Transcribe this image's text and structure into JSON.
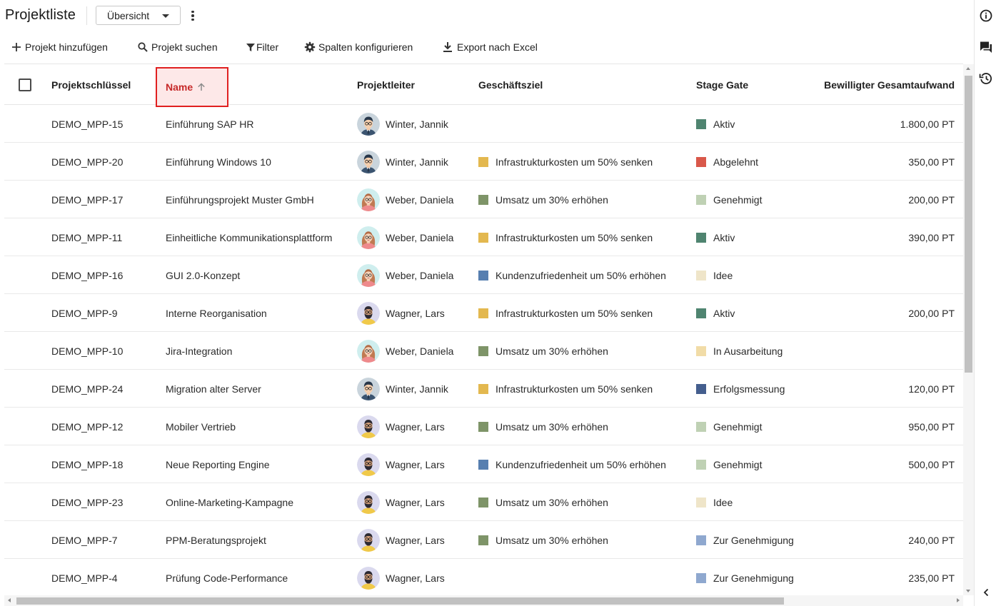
{
  "header": {
    "title": "Projektliste",
    "view_select": "Übersicht"
  },
  "toolbar": {
    "add": "Projekt hinzufügen",
    "search": "Projekt suchen",
    "filter": "Filter",
    "columns": "Spalten konfigurieren",
    "export": "Export nach Excel"
  },
  "columns": {
    "key": "Projektschlüssel",
    "name": "Name",
    "lead": "Projektleiter",
    "goal": "Geschäftsziel",
    "stage": "Stage Gate",
    "effort": "Bewilligter Gesamtaufwand"
  },
  "colors": {
    "goal_infrastructure": "#e3b84f",
    "goal_revenue": "#7e9468",
    "goal_customer": "#577fb0",
    "stage_aktiv": "#4f8470",
    "stage_abgelehnt": "#d9584a",
    "stage_genehmigt": "#bfd1b4",
    "stage_idee": "#efe5c9",
    "stage_in_ausarbeitung": "#f1dca7",
    "stage_erfolgsmessung": "#445e8e",
    "stage_zur_genehmigung": "#8fa8cf",
    "sort_highlight": "#e02020"
  },
  "rows": [
    {
      "key": "DEMO_MPP-15",
      "name": "Einführung SAP HR",
      "lead": "Winter, Jannik",
      "avatar": "winter",
      "goal": "",
      "goal_color": "",
      "stage": "Aktiv",
      "stage_color": "#4f8470",
      "effort": "1.800,00 PT"
    },
    {
      "key": "DEMO_MPP-20",
      "name": "Einführung Windows 10",
      "lead": "Winter, Jannik",
      "avatar": "winter",
      "goal": "Infrastrukturkosten um 50% senken",
      "goal_color": "#e3b84f",
      "stage": "Abgelehnt",
      "stage_color": "#d9584a",
      "effort": "350,00 PT"
    },
    {
      "key": "DEMO_MPP-17",
      "name": "Einführungsprojekt Muster GmbH",
      "lead": "Weber, Daniela",
      "avatar": "weber",
      "goal": "Umsatz um 30% erhöhen",
      "goal_color": "#7e9468",
      "stage": "Genehmigt",
      "stage_color": "#bfd1b4",
      "effort": "200,00 PT"
    },
    {
      "key": "DEMO_MPP-11",
      "name": "Einheitliche Kommunikationsplattform",
      "lead": "Weber, Daniela",
      "avatar": "weber",
      "goal": "Infrastrukturkosten um 50% senken",
      "goal_color": "#e3b84f",
      "stage": "Aktiv",
      "stage_color": "#4f8470",
      "effort": "390,00 PT"
    },
    {
      "key": "DEMO_MPP-16",
      "name": "GUI 2.0-Konzept",
      "lead": "Weber, Daniela",
      "avatar": "weber",
      "goal": "Kundenzufriedenheit um 50% erhöhen",
      "goal_color": "#577fb0",
      "stage": "Idee",
      "stage_color": "#efe5c9",
      "effort": ""
    },
    {
      "key": "DEMO_MPP-9",
      "name": "Interne Reorganisation",
      "lead": "Wagner, Lars",
      "avatar": "wagner",
      "goal": "Infrastrukturkosten um 50% senken",
      "goal_color": "#e3b84f",
      "stage": "Aktiv",
      "stage_color": "#4f8470",
      "effort": "200,00 PT"
    },
    {
      "key": "DEMO_MPP-10",
      "name": "Jira-Integration",
      "lead": "Weber, Daniela",
      "avatar": "weber",
      "goal": "Umsatz um 30% erhöhen",
      "goal_color": "#7e9468",
      "stage": "In Ausarbeitung",
      "stage_color": "#f1dca7",
      "effort": ""
    },
    {
      "key": "DEMO_MPP-24",
      "name": "Migration alter Server",
      "lead": "Winter, Jannik",
      "avatar": "winter",
      "goal": "Infrastrukturkosten um 50% senken",
      "goal_color": "#e3b84f",
      "stage": "Erfolgsmessung",
      "stage_color": "#445e8e",
      "effort": "120,00 PT"
    },
    {
      "key": "DEMO_MPP-12",
      "name": "Mobiler Vertrieb",
      "lead": "Wagner, Lars",
      "avatar": "wagner",
      "goal": "Umsatz um 30% erhöhen",
      "goal_color": "#7e9468",
      "stage": "Genehmigt",
      "stage_color": "#bfd1b4",
      "effort": "950,00 PT"
    },
    {
      "key": "DEMO_MPP-18",
      "name": "Neue Reporting Engine",
      "lead": "Wagner, Lars",
      "avatar": "wagner",
      "goal": "Kundenzufriedenheit um 50% erhöhen",
      "goal_color": "#577fb0",
      "stage": "Genehmigt",
      "stage_color": "#bfd1b4",
      "effort": "500,00 PT"
    },
    {
      "key": "DEMO_MPP-23",
      "name": "Online-Marketing-Kampagne",
      "lead": "Wagner, Lars",
      "avatar": "wagner",
      "goal": "Umsatz um 30% erhöhen",
      "goal_color": "#7e9468",
      "stage": "Idee",
      "stage_color": "#efe5c9",
      "effort": ""
    },
    {
      "key": "DEMO_MPP-7",
      "name": "PPM-Beratungsprojekt",
      "lead": "Wagner, Lars",
      "avatar": "wagner",
      "goal": "Umsatz um 30% erhöhen",
      "goal_color": "#7e9468",
      "stage": "Zur Genehmigung",
      "stage_color": "#8fa8cf",
      "effort": "240,00 PT"
    },
    {
      "key": "DEMO_MPP-4",
      "name": "Prüfung Code-Performance",
      "lead": "Wagner, Lars",
      "avatar": "wagner",
      "goal": "",
      "goal_color": "",
      "stage": "Zur Genehmigung",
      "stage_color": "#8fa8cf",
      "effort": "235,00 PT"
    }
  ]
}
